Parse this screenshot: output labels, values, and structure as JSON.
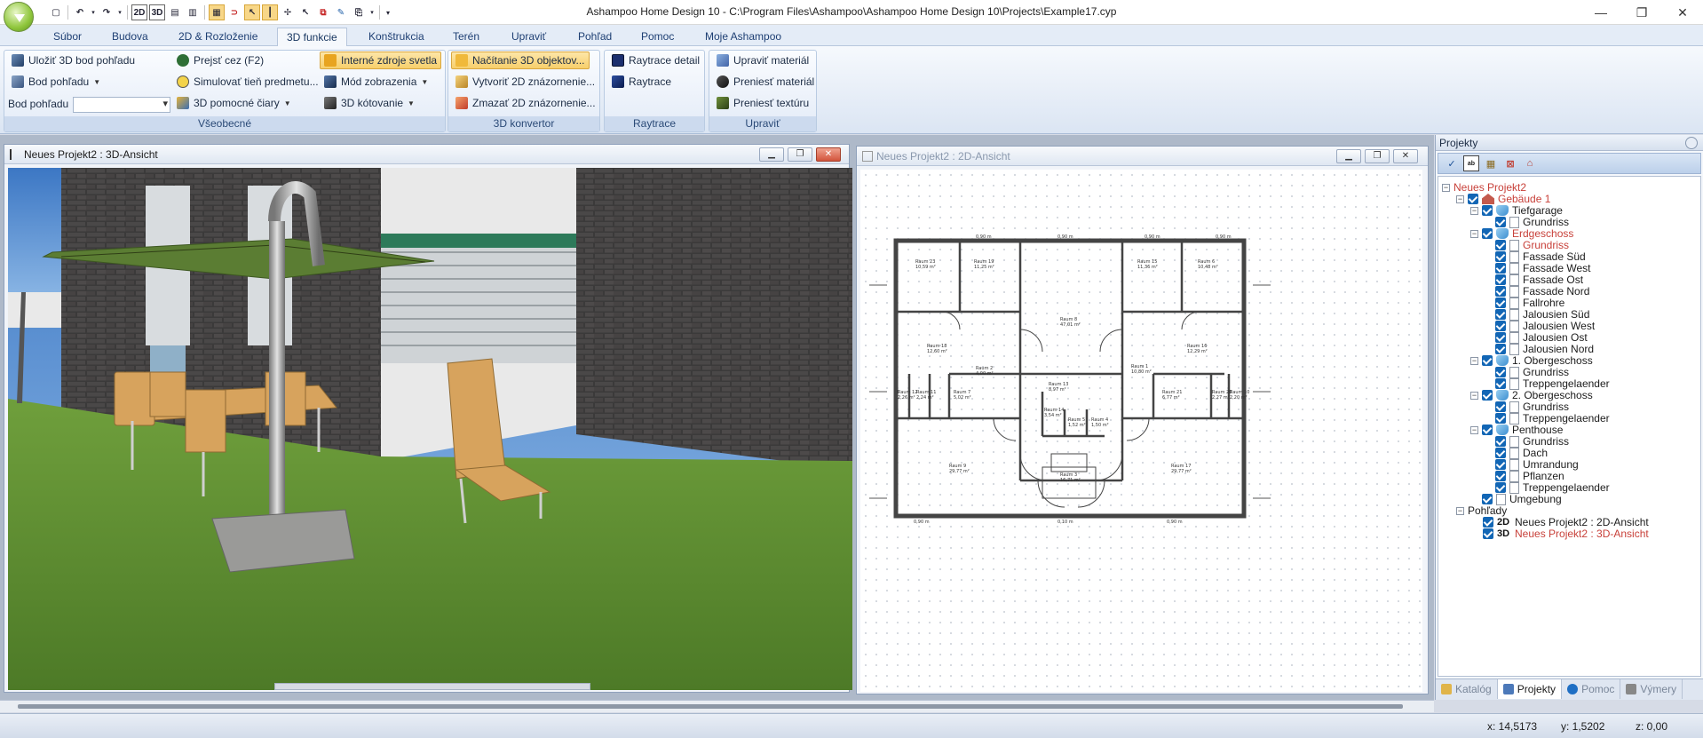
{
  "window": {
    "title": "Ashampoo Home Design 10 - C:\\Program Files\\Ashampoo\\Ashampoo Home Design 10\\Projects\\Example17.cyp",
    "minimize": "—",
    "maximize": "❐",
    "close": "✕"
  },
  "qat": {
    "btn_2d": "2D",
    "btn_3d": "3D"
  },
  "tabs": [
    "Súbor",
    "Budova",
    "2D & Rozloženie",
    "3D funkcie",
    "Konštrukcia",
    "Terén",
    "Upraviť",
    "Pohľad",
    "Pomoc",
    "Moje Ashampoo"
  ],
  "ribbon": {
    "general": {
      "label": "Všeobecné",
      "save_viewpoint": "Uložiť 3D bod pohľadu",
      "viewpoint": "Bod pohľadu",
      "viewpoint_label": "Bod pohľadu",
      "walk_through": "Prejsť cez (F2)",
      "simulate_shadow": "Simulovať tieň predmetu...",
      "guide_lines": "3D pomocné čiary",
      "internal_lights": "Interné zdroje svetla",
      "display_mode": "Mód zobrazenia",
      "dimensioning": "3D kótovanie"
    },
    "converter": {
      "label": "3D konvertor",
      "load_objects": "Načítanie 3D objektov...",
      "create_2d": "Vytvoriť 2D znázornenie...",
      "delete_2d": "Zmazať 2D znázornenie..."
    },
    "raytrace": {
      "label": "Raytrace",
      "detail": "Raytrace detail",
      "raytrace": "Raytrace"
    },
    "edit": {
      "label": "Upraviť",
      "edit_material": "Upraviť materiál",
      "transfer_material": "Preniesť materiál",
      "transfer_texture": "Preniesť textúru"
    }
  },
  "view3d": {
    "title": "Neues Projekt2 : 3D-Ansicht"
  },
  "view2d": {
    "title": "Neues Projekt2 : 2D-Ansicht",
    "dims": [
      "0,90 m",
      "0,90 m",
      "0,90 m",
      "0,90 m",
      "0,90 m",
      "0,90 m",
      "0,10 m"
    ],
    "rooms": [
      {
        "name": "Raum 23",
        "area": "10,59 m²"
      },
      {
        "name": "Raum 19",
        "area": "11,25 m²"
      },
      {
        "name": "Raum 15",
        "area": "11,36 m²"
      },
      {
        "name": "Raum 6",
        "area": "10,48 m²"
      },
      {
        "name": "Raum 8",
        "area": "47,01 m²"
      },
      {
        "name": "Raum 18",
        "area": "12,60 m²"
      },
      {
        "name": "Raum 16",
        "area": "12,29 m²"
      },
      {
        "name": "Raum 2",
        "area": "4,00 m²"
      },
      {
        "name": "Raum 1",
        "area": "10,80 m²"
      },
      {
        "name": "Raum 13",
        "area": "8,97 m²"
      },
      {
        "name": "Raum 12",
        "area": "2,26 m²"
      },
      {
        "name": "Raum 11",
        "area": "2,24 m²"
      },
      {
        "name": "Raum 7",
        "area": "5,02 m²"
      },
      {
        "name": "Raum 21",
        "area": "6,77 m²"
      },
      {
        "name": "Raum 20",
        "area": "2,27 m²"
      },
      {
        "name": "Raum 10",
        "area": "2,20 m²"
      },
      {
        "name": "Raum 14",
        "area": "3,54 m²"
      },
      {
        "name": "Raum 5",
        "area": "1,52 m²"
      },
      {
        "name": "Raum 4",
        "area": "1,50 m²"
      },
      {
        "name": "Raum 9",
        "area": "29,77 m²"
      },
      {
        "name": "Raum 3",
        "area": "16,71 m²"
      },
      {
        "name": "Raum 17",
        "area": "29,77 m²"
      }
    ]
  },
  "projects_panel": {
    "title": "Projekty",
    "tree": {
      "project": "Neues Projekt2",
      "building": "Gebäude 1",
      "tiefgarage": "Tiefgarage",
      "grundriss": "Grundriss",
      "erdgeschoss": "Erdgeschoss",
      "eg_items": [
        "Grundriss",
        "Fassade Süd",
        "Fassade West",
        "Fassade Ost",
        "Fassade Nord",
        "Fallrohre",
        "Jalousien Süd",
        "Jalousien West",
        "Jalousien Ost",
        "Jalousien Nord"
      ],
      "og1": "1. Obergeschoss",
      "og1_items": [
        "Grundriss",
        "Treppengelaender"
      ],
      "og2": "2. Obergeschoss",
      "og2_items": [
        "Grundriss",
        "Treppengelaender"
      ],
      "penthouse": "Penthouse",
      "ph_items": [
        "Grundriss",
        "Dach",
        "Umrandung",
        "Pflanzen",
        "Treppengelaender"
      ],
      "umgebung": "Umgebung",
      "views": "Pohľady",
      "view_2d_badge": "2D",
      "view_2d": "Neues Projekt2 : 2D-Ansicht",
      "view_3d_badge": "3D",
      "view_3d": "Neues Projekt2 : 3D-Ansicht"
    },
    "tabs": [
      "Katalóg",
      "Projekty",
      "Pomoc",
      "Výmery"
    ]
  },
  "status": {
    "x": "x: 14,5173",
    "y": "y: 1,5202",
    "z": "z: 0,00"
  },
  "colors": {
    "accent": "#f7cf6b",
    "tree_red": "#c8413a",
    "ribbon_blue": "#1e3f73"
  }
}
